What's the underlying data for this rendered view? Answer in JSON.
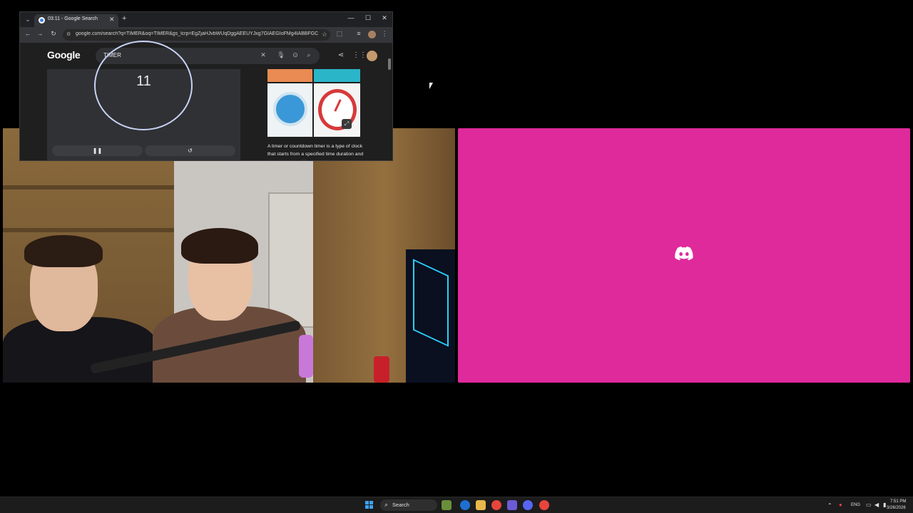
{
  "browser": {
    "tab_title": "03:11 - Google Search",
    "tab_list_icon": "chevron-down-icon",
    "new_tab_symbol": "+",
    "close_symbol": "✕",
    "minimize_symbol": "—",
    "maximize_symbol": "☐",
    "url": "google.com/search?q=TIMER&oq=TIMER&gs_lcrp=EgZjaHJvbWUqDggAEEUYJxg7GIAEGIoFMg4IABBFGCc...",
    "nav": {
      "back": "←",
      "forward": "→",
      "reload": "↻"
    },
    "page": {
      "logo": "Google",
      "search_query": "TIMER",
      "timer_value": "11",
      "pause_symbol": "❚❚",
      "reset_symbol": "↺",
      "description": "A timer or countdown timer is a type of clock that starts from a specified time duration and stops upon reaching..."
    }
  },
  "discord": {
    "bg_color": "#df2a9c",
    "icon": "discord-icon"
  },
  "taskbar": {
    "search_label": "Search",
    "language": "ENG",
    "time": "7:51 PM",
    "date": "3/26/2026"
  }
}
